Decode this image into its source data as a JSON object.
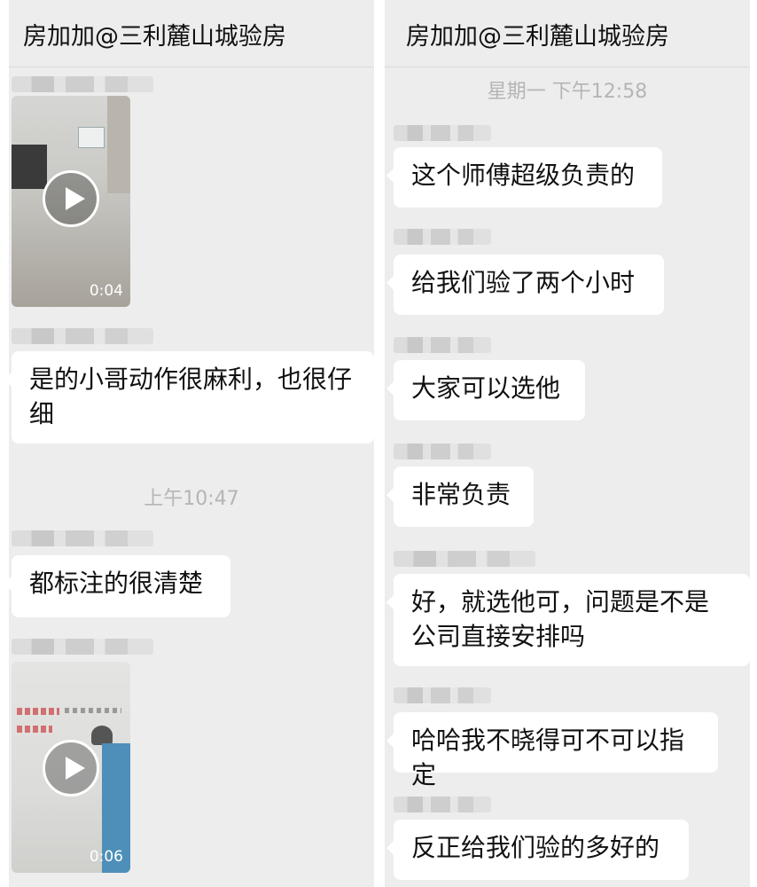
{
  "left": {
    "title": "房加加@三利麓山城验房",
    "video1_duration": "0:04",
    "msg1": "是的小哥动作很麻利，也很仔细",
    "time1": "上午10:47",
    "msg2": "都标注的很清楚",
    "video2_duration": "0:06"
  },
  "right": {
    "title": "房加加@三利麓山城验房",
    "time1": "星期一 下午12:58",
    "messages": [
      "这个师傅超级负责的",
      "给我们验了两个小时",
      "大家可以选他",
      "非常负责",
      "好，就选他可，问题是不是公司直接安排吗",
      "哈哈我不晓得可不可以指定",
      "反正给我们验的多好的"
    ]
  }
}
